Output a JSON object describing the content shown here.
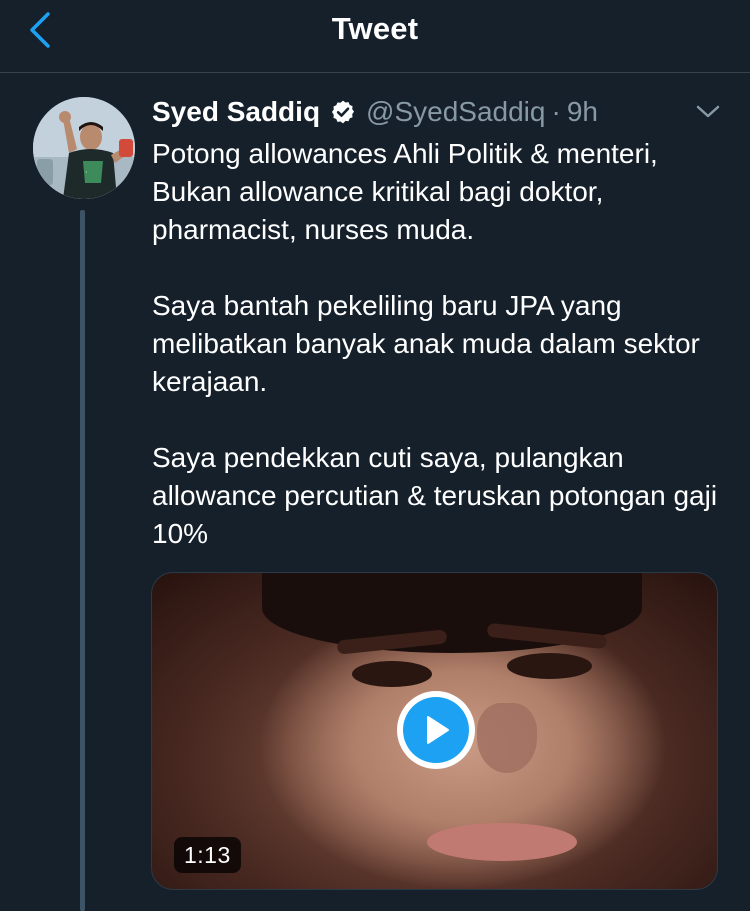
{
  "header": {
    "title": "Tweet",
    "back_icon": "chevron-left-icon"
  },
  "colors": {
    "background": "#15202b",
    "accent": "#1da1f2",
    "secondary_text": "#8899a6",
    "divider": "#38444d"
  },
  "tweet": {
    "display_name": "Syed Saddiq",
    "verified": true,
    "handle": "@SyedSaddiq",
    "separator": "·",
    "time": "9h",
    "paragraphs": [
      "Potong allowances Ahli Politik & menteri, Bukan allowance kritikal bagi doktor, pharmacist, nurses muda.",
      "Saya bantah pekeliling baru JPA yang melibatkan banyak anak muda dalam sektor kerajaan.",
      "Saya pendekkan cuti saya, pulangkan allowance percutian & teruskan potongan gaji 10%"
    ],
    "video": {
      "duration": "1:13",
      "play_icon": "play-icon"
    }
  }
}
